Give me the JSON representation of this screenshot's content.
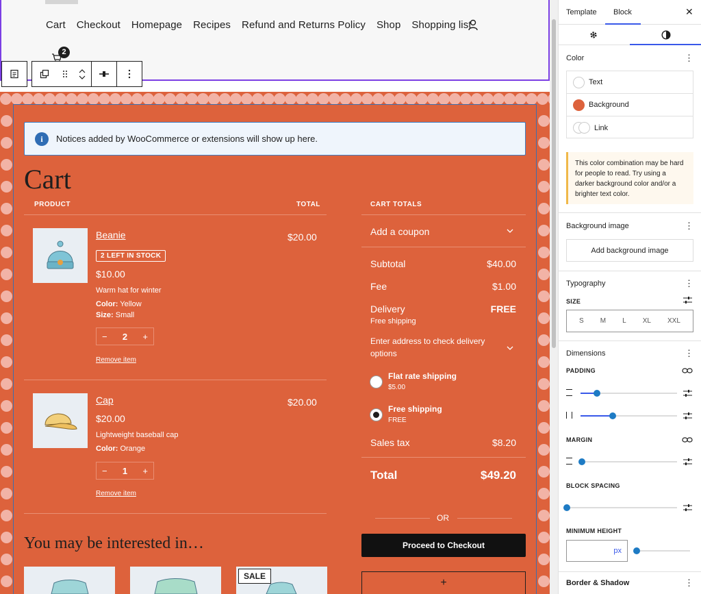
{
  "header": {
    "nav": [
      "Cart",
      "Checkout",
      "Homepage",
      "Recipes",
      "Refund and Returns Policy",
      "Shop",
      "Shopping list"
    ],
    "mini_cart_count": "2"
  },
  "notice": {
    "text": "Notices added by WooCommerce or extensions will show up here."
  },
  "cart": {
    "title": "Cart",
    "col_product": "PRODUCT",
    "col_total": "TOTAL",
    "items": [
      {
        "name": "Beanie",
        "stock": "2 LEFT IN STOCK",
        "unit_price": "$10.00",
        "description": "Warm hat for winter",
        "attr1_label": "Color:",
        "attr1_value": "Yellow",
        "attr2_label": "Size:",
        "attr2_value": "Small",
        "qty": "2",
        "remove": "Remove item",
        "total": "$20.00"
      },
      {
        "name": "Cap",
        "unit_price": "$20.00",
        "description": "Lightweight baseball cap",
        "attr1_label": "Color:",
        "attr1_value": "Orange",
        "qty": "1",
        "remove": "Remove item",
        "total": "$20.00"
      }
    ],
    "qty_minus": "−",
    "qty_plus": "+"
  },
  "totals": {
    "heading": "CART TOTALS",
    "coupon": "Add a coupon",
    "subtotal_label": "Subtotal",
    "subtotal_value": "$40.00",
    "fee_label": "Fee",
    "fee_value": "$1.00",
    "delivery_label": "Delivery",
    "delivery_value": "FREE",
    "delivery_note": "Free shipping",
    "address_prompt_1": "Enter address to check delivery",
    "address_prompt_2": "options",
    "shipping_options": [
      {
        "label": "Flat rate shipping",
        "price": "$5.00",
        "selected": false
      },
      {
        "label": "Free shipping",
        "price": "FREE",
        "selected": true
      }
    ],
    "tax_label": "Sales tax",
    "tax_value": "$8.20",
    "total_label": "Total",
    "total_value": "$49.20",
    "or": "OR",
    "checkout_button": "Proceed to Checkout",
    "add_block": "+"
  },
  "interested": {
    "title": "You may be interested in…",
    "sale_badge": "SALE"
  },
  "sidebar": {
    "tab_template": "Template",
    "tab_block": "Block",
    "close": "✕",
    "color_heading": "Color",
    "color_items": [
      {
        "label": "Text",
        "color": "#ffffff"
      },
      {
        "label": "Background",
        "color": "#dd623c"
      },
      {
        "label": "Link",
        "color": "#ffffff"
      }
    ],
    "contrast_warning": "This color combination may be hard for people to read. Try using a darker background color and/or a brighter text color.",
    "bg_image_heading": "Background image",
    "add_bg_button": "Add background image",
    "typography_heading": "Typography",
    "size_label": "SIZE",
    "sizes": [
      "S",
      "M",
      "L",
      "XL",
      "XXL"
    ],
    "dimensions_heading": "Dimensions",
    "padding_label": "PADDING",
    "margin_label": "MARGIN",
    "block_spacing_label": "BLOCK SPACING",
    "min_height_label": "MINIMUM HEIGHT",
    "min_height_unit": "px",
    "border_heading": "Border & Shadow"
  },
  "colors": {
    "accent": "#3858e9",
    "cart_background": "#dd623c",
    "dot": "#f2b3a6",
    "selection": "#7b3fe4"
  }
}
